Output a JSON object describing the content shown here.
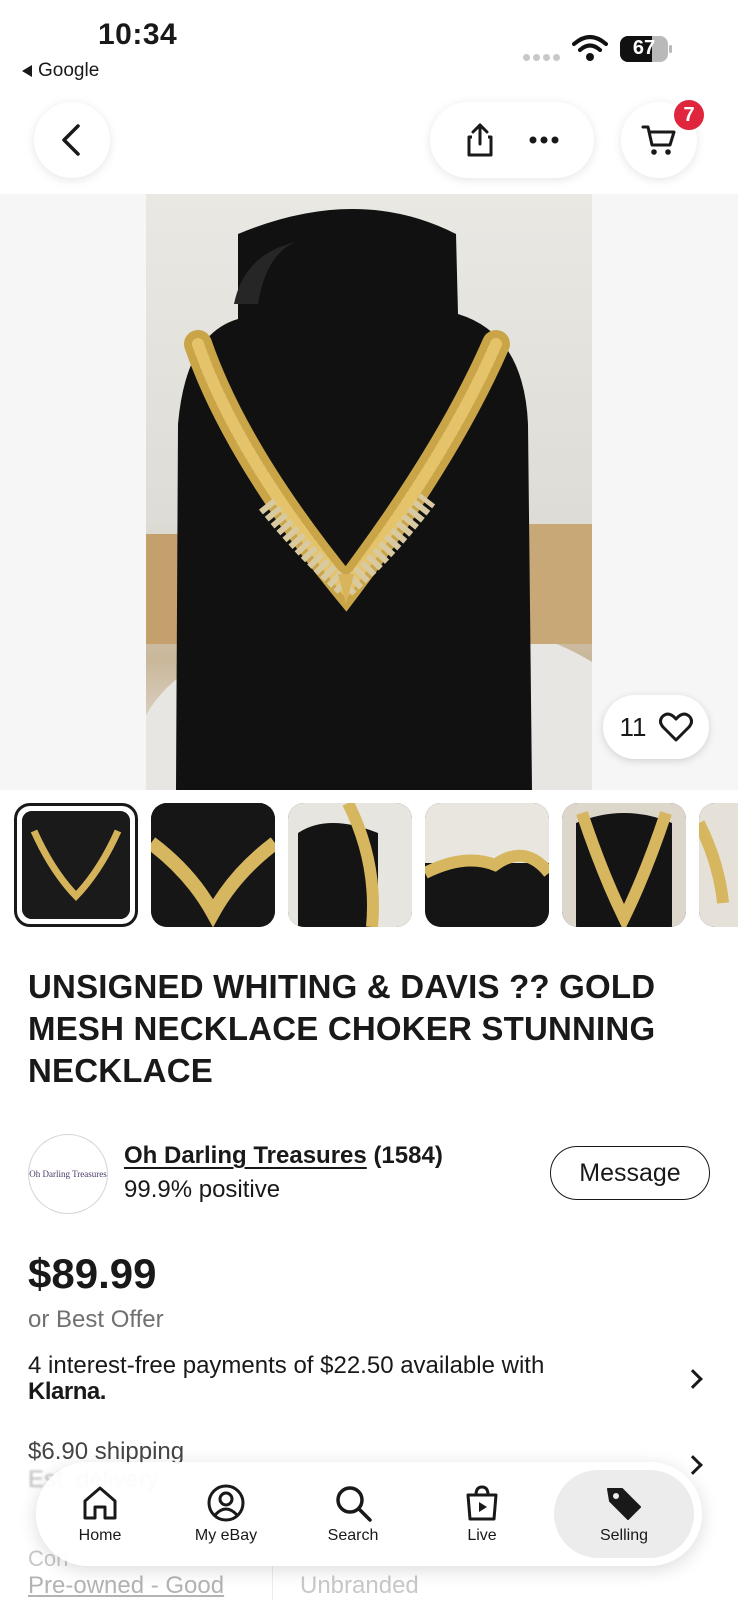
{
  "status_bar": {
    "time": "10:34",
    "back_app": "Google",
    "battery_percent": "67",
    "battery_level": 0.67
  },
  "cart": {
    "badge_count": "7"
  },
  "hero": {
    "watch_count": "11"
  },
  "thumbnails": {
    "count_visible": 6,
    "selected_index": 0
  },
  "listing": {
    "title": "UNSIGNED WHITING & DAVIS ?? GOLD MESH  NECKLACE CHOKER STUNNING NECKLACE",
    "price": "$89.99",
    "best_offer": "or Best Offer",
    "klarna_text": "4 interest-free payments of $22.50 available with",
    "klarna_brand": "Klarna.",
    "shipping": "$6.90 shipping",
    "shipping_faded": "Est. delivery"
  },
  "seller": {
    "logo_text": "Oh Darling Treasures",
    "name": "Oh Darling Treasures",
    "feedback_count": "(1584)",
    "positive": "99.9% positive",
    "message_label": "Message"
  },
  "details": {
    "condition_label": "Con",
    "condition_value": "Pre-owned - Good",
    "brand_value": "Unbranded"
  },
  "tabbar": {
    "items": [
      {
        "label": "Home",
        "icon": "home-icon"
      },
      {
        "label": "My eBay",
        "icon": "user-icon"
      },
      {
        "label": "Search",
        "icon": "search-icon"
      },
      {
        "label": "Live",
        "icon": "live-bag-icon"
      },
      {
        "label": "Selling",
        "icon": "tag-icon"
      }
    ],
    "active": "Selling"
  },
  "colors": {
    "badge": "#e0263d",
    "text": "#191919",
    "muted": "#707070"
  }
}
